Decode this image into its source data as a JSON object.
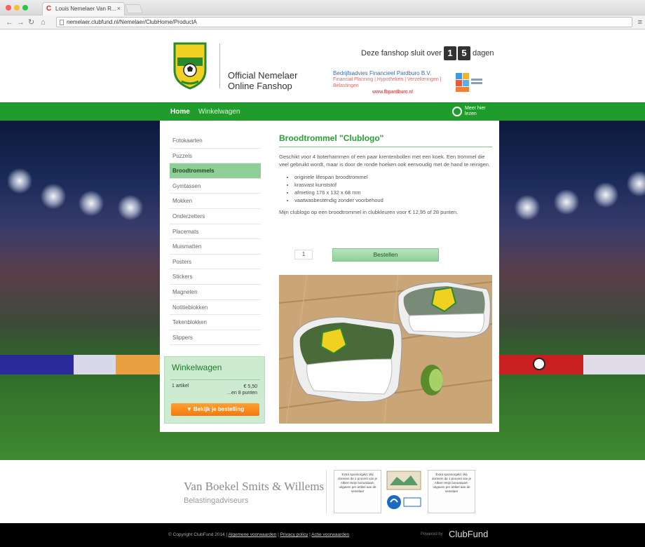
{
  "browser": {
    "tab_title": "Louis Nemelaer Van R...",
    "favicon_letter": "C",
    "url": "nemelaer.clubfund.nl/Nemelaer/ClubHome/ProductA"
  },
  "header": {
    "logo_line1": "Official Nemelaer",
    "logo_line2": "Online Fanshop",
    "countdown_pre": "Deze fanshop sluit over",
    "digit1": "1",
    "digit2": "5",
    "countdown_post": "dagen",
    "sponsor_name": "Bedrijfsadvies Financieel Pardburo B.V.",
    "sponsor_sub": "Financial Planning | Hypotheken | Verzekeringen | Belastingen",
    "sponsor_url": "www.fbpardburo.nl"
  },
  "nav": {
    "home": "Home",
    "cart": "Winkelwagen",
    "meer_line1": "Meer hier",
    "meer_line2": "lezen"
  },
  "categories": [
    "Fotokaarten",
    "Puzzels",
    "Broodtrommels",
    "Gymtassen",
    "Mokken",
    "Onderzetters",
    "Placemats",
    "Muismatten",
    "Posters",
    "Stickers",
    "Magneten",
    "Notitieblokken",
    "Tekenblokken",
    "Slippers"
  ],
  "active_category": "Broodtrommels",
  "cart": {
    "title": "Winkelwagen",
    "item": "1 artikel",
    "price": "€ 5,50",
    "points": "...en 8 punten",
    "checkout_label": "▼ Bekijk je bestelling"
  },
  "product": {
    "title": "Broodtrommel \"Clublogo\"",
    "description": "Geschikt voor 4 boterhammen of een paar krentenbollen met een koek. Een trommel die veel gebruikt wordt, maar is door de ronde hoeken ook eenvoudig met de hand te reinigen.",
    "bullets": [
      "originele lifespan broodtrommel",
      "krasvast kunststof",
      "afmeting 176 x 132 x 68 mm",
      "vaatwasbestendig zonder voorbehoud"
    ],
    "price_line": "Mijn clublogo op een broodtrommel in clubkleuren voor € 12,95 of 28 punten.",
    "quantity": "1",
    "order_label": "Bestellen"
  },
  "footer": {
    "vbsw_name": "Van Boekel Smits & Willems",
    "vbsw_sub": "Belastingadviseurs",
    "card_left": "Extra sponsorgeld. Wij doneren de 1 procent van je Albert Heijn bonuskaart-uitgaven per artikel aan de nemelaer",
    "card_right": "Extra sponsorgeld. Wij doneren de 1 procent van je Albert Heijn bonuskaart-uitgaven per artikel aan de nemelaer",
    "ah_label": "Albert Heijn",
    "copyright": "© Copyright ClubFund 2014 |",
    "link1": "Algemene voorwaarden",
    "link2": "Privacy policy",
    "link3": "Actie voorwaarden",
    "powered": "Powered by",
    "brand": "ClubFund"
  },
  "colors": {
    "brand_green": "#1f9c2b",
    "accent_orange": "#f07a10",
    "crest_yellow": "#f0d020"
  }
}
